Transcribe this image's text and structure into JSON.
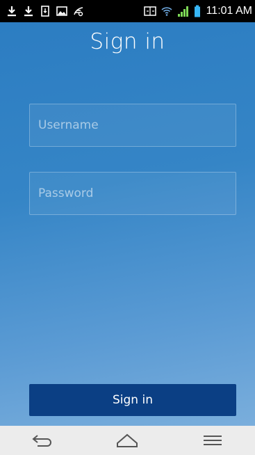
{
  "status_bar": {
    "time": "11:01 AM",
    "left_icons": [
      "download-icon",
      "download-icon",
      "sd-card-icon",
      "image-icon",
      "tag-icon"
    ],
    "right_icons": [
      "screen-mirror-icon",
      "wifi-icon",
      "signal-icon",
      "battery-icon"
    ]
  },
  "page": {
    "title": "Sign in"
  },
  "form": {
    "username_placeholder": "Username",
    "username_value": "",
    "password_placeholder": "Password",
    "password_value": "",
    "submit_label": "Sign in"
  },
  "nav": {
    "buttons": [
      "back-icon",
      "home-icon",
      "menu-icon"
    ]
  },
  "colors": {
    "gradient_top": "#2c7dc2",
    "gradient_bottom": "#7aaedc",
    "button": "#0b3f84",
    "nav_bar": "#ececec",
    "battery": "#37b6f6",
    "signal": "#7ed957"
  }
}
